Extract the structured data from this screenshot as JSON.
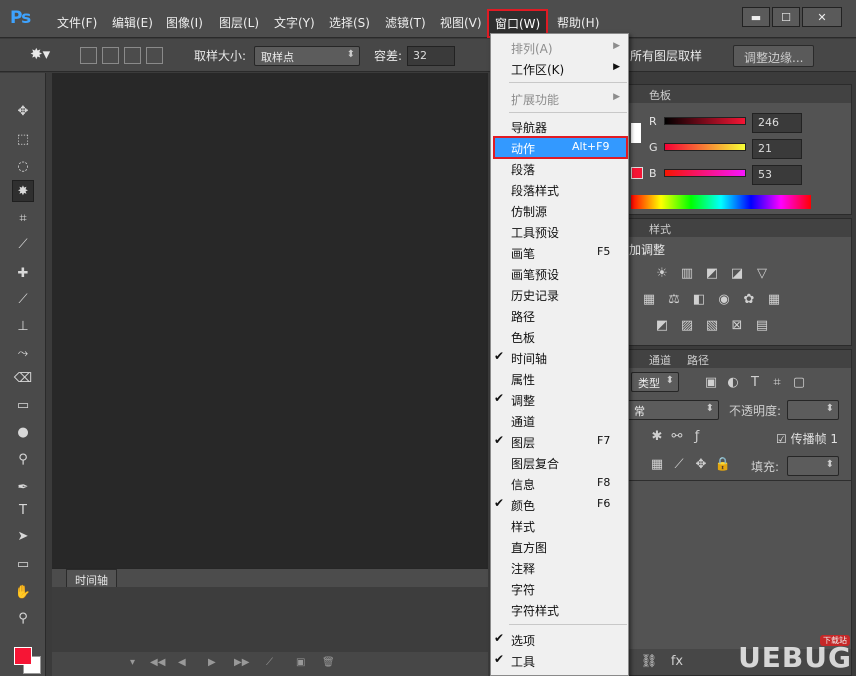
{
  "app": {
    "logo": "Ps"
  },
  "menubar": {
    "items": [
      "文件(F)",
      "编辑(E)",
      "图像(I)",
      "图层(L)",
      "文字(Y)",
      "选择(S)",
      "滤镜(T)",
      "视图(V)",
      "窗口(W)",
      "帮助(H)"
    ],
    "active": "窗口(W)"
  },
  "window_controls": {
    "minimize": "▬",
    "maximize": "☐",
    "close": "✕"
  },
  "options": {
    "sample_size_label": "取样大小:",
    "sample_size_value": "取样点",
    "tolerance_label": "容差:",
    "tolerance_value": "32",
    "all_layers_label": "所有图层取样",
    "refine_edge_button": "调整边缘..."
  },
  "color_panel": {
    "tabs": [
      "色板"
    ],
    "channels": [
      {
        "label": "R",
        "value": "246"
      },
      {
        "label": "G",
        "value": "21"
      },
      {
        "label": "B",
        "value": "53"
      }
    ],
    "accent": "#f61535"
  },
  "adjustments_panel": {
    "tabs": [
      "样式"
    ],
    "title": "加调整"
  },
  "layers_panel": {
    "tabs": [
      "通道",
      "路径"
    ],
    "filter_label": "类型",
    "blend_mode": "常",
    "opacity_label": "不透明度:",
    "propagate_label": "传播帧 1",
    "fill_label": "填充:"
  },
  "timeline": {
    "tab_label": "时间轴"
  },
  "dropdown": {
    "items": [
      {
        "label": "排列(A)",
        "disabled": true,
        "submenu": true
      },
      {
        "label": "工作区(K)",
        "submenu": true
      },
      {
        "sep": true
      },
      {
        "label": "扩展功能",
        "disabled": true,
        "submenu": true
      },
      {
        "sep": true
      },
      {
        "label": "导航器"
      },
      {
        "label": "动作",
        "shortcut": "Alt+F9",
        "highlighted": true
      },
      {
        "label": "段落"
      },
      {
        "label": "段落样式"
      },
      {
        "label": "仿制源"
      },
      {
        "label": "工具预设"
      },
      {
        "label": "画笔",
        "shortcut": "F5"
      },
      {
        "label": "画笔预设"
      },
      {
        "label": "历史记录"
      },
      {
        "label": "路径"
      },
      {
        "label": "色板"
      },
      {
        "label": "时间轴",
        "checked": true
      },
      {
        "label": "属性"
      },
      {
        "label": "调整",
        "checked": true
      },
      {
        "label": "通道"
      },
      {
        "label": "图层",
        "checked": true,
        "shortcut": "F7"
      },
      {
        "label": "图层复合"
      },
      {
        "label": "信息",
        "shortcut": "F8"
      },
      {
        "label": "颜色",
        "checked": true,
        "shortcut": "F6"
      },
      {
        "label": "样式"
      },
      {
        "label": "直方图"
      },
      {
        "label": "注释"
      },
      {
        "label": "字符"
      },
      {
        "label": "字符样式"
      },
      {
        "sep": true
      },
      {
        "label": "选项",
        "checked": true
      },
      {
        "label": "工具",
        "checked": true
      }
    ]
  },
  "watermark": {
    "text": "UEBUG",
    "sub": "下载站"
  }
}
